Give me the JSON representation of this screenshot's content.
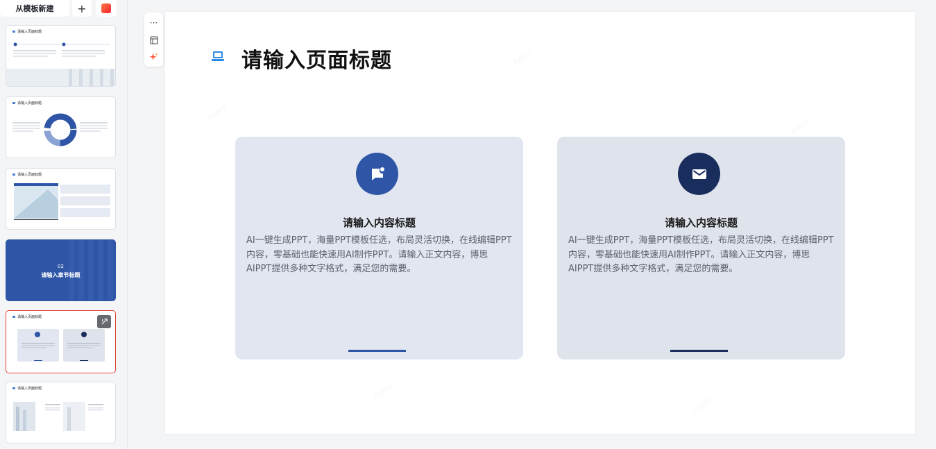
{
  "sidebar": {
    "template_button": "从模板新建",
    "add_button": "+",
    "thumbnails": [
      {
        "title": "请输入页面标题"
      },
      {
        "title": "请输入页面标题"
      },
      {
        "title": "请输入页面标题"
      },
      {
        "section_number": "02",
        "section_title": "请输入章节标题"
      },
      {
        "title": "请输入页面标题",
        "card_title": "请输入内容标题"
      },
      {
        "title": "请输入页面标题",
        "card_title": "请输入内容标题"
      }
    ]
  },
  "toolbar": {
    "more_label": "···"
  },
  "slide": {
    "title": "请输入页面标题",
    "cards": [
      {
        "icon": "message-icon",
        "title": "请输入内容标题",
        "body": "AI一键生成PPT，海量PPT模板任选，布局灵活切换，在线编辑PPT内容，零基础也能快速用AI制作PPT。请输入正文内容，博思AIPPT提供多种文字格式，满足您的需要。",
        "accent": "#2e55a6"
      },
      {
        "icon": "mail-icon",
        "title": "请输入内容标题",
        "body": "AI一键生成PPT，海量PPT模板任选，布局灵活切换，在线编辑PPT内容，零基础也能快速用AI制作PPT。请输入正文内容，博思AIPPT提供多种文字格式，满足您的需要。",
        "accent": "#1a2e5e"
      }
    ]
  },
  "colors": {
    "primary": "#2e55a6",
    "dark": "#1a2e5e",
    "active_border": "#e0453a"
  }
}
